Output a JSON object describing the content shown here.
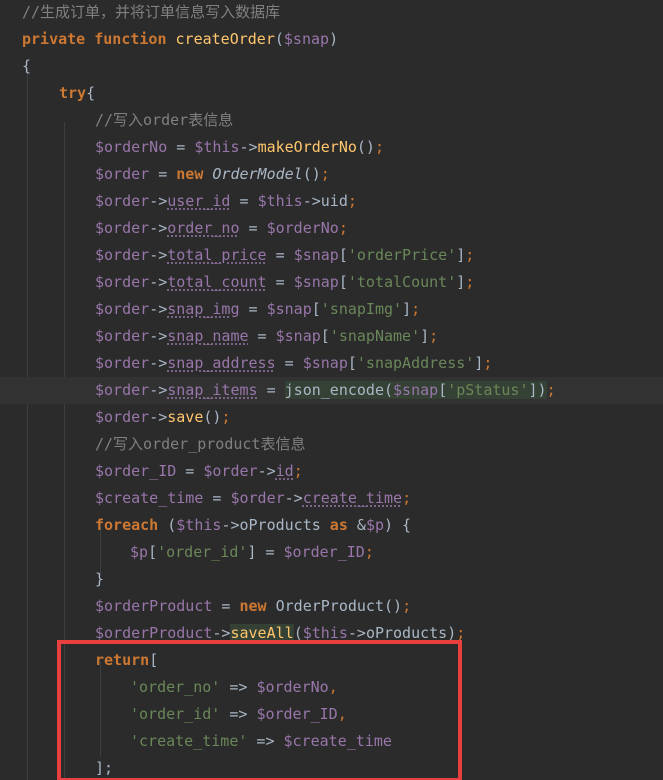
{
  "editor": {
    "title_comment": "//生成订单，并将订单信息写入数据库",
    "function_keyword": "private function",
    "function_name": "createOrder",
    "function_param": "($snap)",
    "lines": [
      {
        "tokens": [
          [
            "//生成订单，并将订单信息写入数据库",
            "comment"
          ]
        ]
      },
      {
        "tokens": [
          [
            "private function ",
            "kw"
          ],
          [
            "createOrder",
            "fn"
          ],
          [
            "(",
            "plain"
          ],
          [
            "$snap",
            "var"
          ],
          [
            ")",
            "plain"
          ]
        ]
      },
      {
        "tokens": [
          [
            "{",
            "plain"
          ]
        ]
      },
      {
        "tokens": [
          [
            "try",
            "kw"
          ],
          [
            "{",
            "plain"
          ]
        ]
      },
      {
        "tokens": [
          [
            "//写入order表信息",
            "comment"
          ]
        ]
      },
      {
        "tokens": [
          [
            "$orderNo",
            "var"
          ],
          [
            " = ",
            "plain"
          ],
          [
            "$this",
            "var"
          ],
          [
            "->",
            "plain"
          ],
          [
            "makeOrderNo",
            "fn"
          ],
          [
            "()",
            "plain"
          ],
          [
            ";",
            "semi"
          ]
        ]
      },
      {
        "tokens": [
          [
            "$order",
            "var"
          ],
          [
            " = ",
            "plain"
          ],
          [
            "new ",
            "kw"
          ],
          [
            "OrderModel",
            "cls"
          ],
          [
            "()",
            "plain"
          ],
          [
            ";",
            "semi"
          ]
        ]
      },
      {
        "tokens": [
          [
            "$order",
            "var"
          ],
          [
            "->",
            "plain"
          ],
          [
            "user_id",
            "prop"
          ],
          [
            " = ",
            "plain"
          ],
          [
            "$this",
            "var"
          ],
          [
            "->",
            "plain"
          ],
          [
            "uid",
            "plain"
          ],
          [
            ";",
            "semi"
          ]
        ]
      },
      {
        "tokens": [
          [
            "$order",
            "var"
          ],
          [
            "->",
            "plain"
          ],
          [
            "order_no",
            "prop"
          ],
          [
            " = ",
            "plain"
          ],
          [
            "$orderNo",
            "var"
          ],
          [
            ";",
            "semi"
          ]
        ]
      },
      {
        "tokens": [
          [
            "$order",
            "var"
          ],
          [
            "->",
            "plain"
          ],
          [
            "total_price",
            "prop"
          ],
          [
            " = ",
            "plain"
          ],
          [
            "$snap",
            "var"
          ],
          [
            "[",
            "plain"
          ],
          [
            "'orderPrice'",
            "str"
          ],
          [
            "]",
            "plain"
          ],
          [
            ";",
            "semi"
          ]
        ]
      },
      {
        "tokens": [
          [
            "$order",
            "var"
          ],
          [
            "->",
            "plain"
          ],
          [
            "total_count",
            "prop"
          ],
          [
            " = ",
            "plain"
          ],
          [
            "$snap",
            "var"
          ],
          [
            "[",
            "plain"
          ],
          [
            "'totalCount'",
            "str"
          ],
          [
            "]",
            "plain"
          ],
          [
            ";",
            "semi"
          ]
        ]
      },
      {
        "tokens": [
          [
            "$order",
            "var"
          ],
          [
            "->",
            "plain"
          ],
          [
            "snap_img",
            "prop"
          ],
          [
            " = ",
            "plain"
          ],
          [
            "$snap",
            "var"
          ],
          [
            "[",
            "plain"
          ],
          [
            "'snapImg'",
            "str"
          ],
          [
            "]",
            "plain"
          ],
          [
            ";",
            "semi"
          ]
        ]
      },
      {
        "tokens": [
          [
            "$order",
            "var"
          ],
          [
            "->",
            "plain"
          ],
          [
            "snap_name",
            "prop"
          ],
          [
            " = ",
            "plain"
          ],
          [
            "$snap",
            "var"
          ],
          [
            "[",
            "plain"
          ],
          [
            "'snapName'",
            "str"
          ],
          [
            "]",
            "plain"
          ],
          [
            ";",
            "semi"
          ]
        ]
      },
      {
        "tokens": [
          [
            "$order",
            "var"
          ],
          [
            "->",
            "plain"
          ],
          [
            "snap_address",
            "prop"
          ],
          [
            " = ",
            "plain"
          ],
          [
            "$snap",
            "var"
          ],
          [
            "[",
            "plain"
          ],
          [
            "'snapAddress'",
            "str"
          ],
          [
            "]",
            "plain"
          ],
          [
            ";",
            "semi"
          ]
        ]
      },
      {
        "tokens": [
          [
            "$order",
            "var"
          ],
          [
            "->",
            "plain"
          ],
          [
            "snap_items",
            "prop"
          ],
          [
            " = ",
            "plain"
          ],
          [
            "json_encode(",
            "hl"
          ],
          [
            "$snap",
            "hlvar"
          ],
          [
            "[",
            "hl"
          ],
          [
            "'pStatus'",
            "hlstr"
          ],
          [
            "])",
            "hl"
          ],
          [
            ";",
            "semi"
          ]
        ],
        "current": true
      },
      {
        "tokens": [
          [
            "$order",
            "var"
          ],
          [
            "->",
            "plain"
          ],
          [
            "save",
            "fn"
          ],
          [
            "()",
            "plain"
          ],
          [
            ";",
            "semi"
          ]
        ]
      },
      {
        "tokens": [
          [
            "//写入order_product表信息",
            "comment"
          ]
        ]
      },
      {
        "tokens": [
          [
            "$order_ID",
            "var"
          ],
          [
            " = ",
            "plain"
          ],
          [
            "$order",
            "var"
          ],
          [
            "->",
            "plain"
          ],
          [
            "id",
            "prop"
          ],
          [
            ";",
            "semi"
          ]
        ]
      },
      {
        "tokens": [
          [
            "$create_time",
            "var"
          ],
          [
            " = ",
            "plain"
          ],
          [
            "$order",
            "var"
          ],
          [
            "->",
            "plain"
          ],
          [
            "create_time",
            "prop"
          ],
          [
            ";",
            "semi"
          ]
        ]
      },
      {
        "tokens": [
          [
            "foreach",
            "kw"
          ],
          [
            " (",
            "plain"
          ],
          [
            "$this",
            "var"
          ],
          [
            "->",
            "plain"
          ],
          [
            "oProducts",
            "plain"
          ],
          [
            " as ",
            "kw"
          ],
          [
            "&",
            "plain"
          ],
          [
            "$p",
            "var"
          ],
          [
            ") {",
            "plain"
          ]
        ]
      },
      {
        "tokens": [
          [
            "$p",
            "var"
          ],
          [
            "[",
            "plain"
          ],
          [
            "'order_id'",
            "str"
          ],
          [
            "] = ",
            "plain"
          ],
          [
            "$order_ID",
            "var"
          ],
          [
            ";",
            "semi"
          ]
        ]
      },
      {
        "tokens": [
          [
            "}",
            "plain"
          ]
        ]
      },
      {
        "tokens": [
          [
            "$orderProduct",
            "var"
          ],
          [
            " = ",
            "plain"
          ],
          [
            "new ",
            "kw"
          ],
          [
            "OrderProduct",
            "plain"
          ],
          [
            "()",
            "plain"
          ],
          [
            ";",
            "semi"
          ]
        ]
      },
      {
        "tokens": [
          [
            "$orderProduct",
            "var"
          ],
          [
            "->",
            "plain"
          ],
          [
            "saveAll",
            "hlfn"
          ],
          [
            "(",
            "plain"
          ],
          [
            "$this",
            "var"
          ],
          [
            "->",
            "plain"
          ],
          [
            "oProducts",
            "plain"
          ],
          [
            ")",
            "plain"
          ],
          [
            ";",
            "semi"
          ]
        ]
      },
      {
        "tokens": [
          [
            "return",
            "kw"
          ],
          [
            "[",
            "plain"
          ]
        ]
      },
      {
        "tokens": [
          [
            "'order_no'",
            "str"
          ],
          [
            " => ",
            "plain"
          ],
          [
            "$orderNo",
            "var"
          ],
          [
            ",",
            "semi"
          ]
        ]
      },
      {
        "tokens": [
          [
            "'order_id'",
            "str"
          ],
          [
            " => ",
            "plain"
          ],
          [
            "$order_ID",
            "var"
          ],
          [
            ",",
            "semi"
          ]
        ]
      },
      {
        "tokens": [
          [
            "'create_time'",
            "str"
          ],
          [
            " => ",
            "plain"
          ],
          [
            "$create_time",
            "var"
          ]
        ]
      },
      {
        "tokens": [
          [
            "];",
            "plain"
          ]
        ]
      }
    ]
  },
  "colors": {
    "background": "#2B2B2B",
    "current_line": "#323232",
    "plain": "#A9B7C6",
    "keyword": "#CC7832",
    "function": "#FFC66D",
    "variable": "#9876AA",
    "string": "#6A8759",
    "comment": "#808080",
    "highlight_bg": "#344134",
    "annotation_box": "#E8403E"
  }
}
